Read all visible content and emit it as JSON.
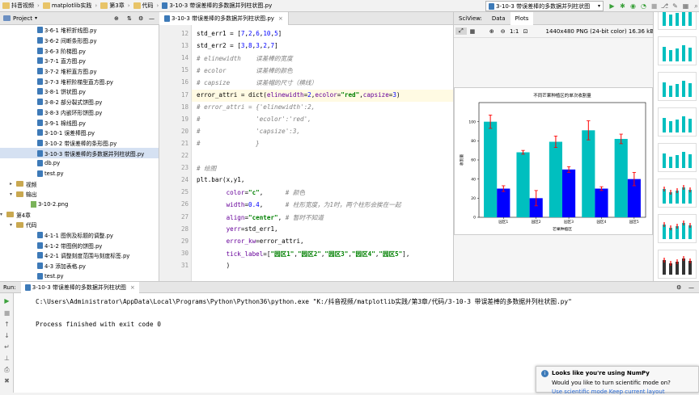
{
  "nav": {
    "crumbs": [
      "抖音视频",
      "matplotlib实践",
      "第3章",
      "代码",
      "3-10-3 带误差棒的多数据并列柱状图.py"
    ],
    "run_config": "3-10-3 带误差棒的多数据并列柱状图"
  },
  "project": {
    "title": "Project",
    "items": [
      {
        "name": "3-6-1 堆积折线图.py",
        "type": "py",
        "indent": 46
      },
      {
        "name": "3-6-2 间断条形图.py",
        "type": "py",
        "indent": 46
      },
      {
        "name": "3-6-3 阶梯图.py",
        "type": "py",
        "indent": 46
      },
      {
        "name": "3-7-1 直方图.py",
        "type": "py",
        "indent": 46
      },
      {
        "name": "3-7-2 堆积直方图.py",
        "type": "py",
        "indent": 46
      },
      {
        "name": "3-7-3 堆积阶梯型直方图.py",
        "type": "py",
        "indent": 46
      },
      {
        "name": "3-8-1 饼状图.py",
        "type": "py",
        "indent": 46
      },
      {
        "name": "3-8-2 部分裂式饼图.py",
        "type": "py",
        "indent": 46
      },
      {
        "name": "3-8-3 内嵌环形饼图.py",
        "type": "py",
        "indent": 46
      },
      {
        "name": "3-9-1 棉线图.py",
        "type": "py",
        "indent": 46
      },
      {
        "name": "3-10-1 误差棒图.py",
        "type": "py",
        "indent": 46
      },
      {
        "name": "3-10-2 带误差棒的条形图.py",
        "type": "py",
        "indent": 46
      },
      {
        "name": "3-10-3 带误差棒的多数据并列柱状图.py",
        "type": "py",
        "indent": 46,
        "selected": true
      },
      {
        "name": "db.py",
        "type": "py",
        "indent": 46
      },
      {
        "name": "test.py",
        "type": "py",
        "indent": 46
      },
      {
        "name": "视频",
        "type": "folder",
        "indent": 22,
        "arrow": "▸"
      },
      {
        "name": "输出",
        "type": "folder",
        "indent": 22,
        "arrow": "▾"
      },
      {
        "name": "3-10-2.png",
        "type": "png",
        "indent": 38
      },
      {
        "name": "第4章",
        "type": "folder",
        "indent": 10,
        "arrow": "▾"
      },
      {
        "name": "代码",
        "type": "folder",
        "indent": 22,
        "arrow": "▾"
      },
      {
        "name": "4-1-1 图例及标题的调整.py",
        "type": "py",
        "indent": 46
      },
      {
        "name": "4-1-2 带图例的饼图.py",
        "type": "py",
        "indent": 46
      },
      {
        "name": "4-2-1 调整刻度范围与刻度标签.py",
        "type": "py",
        "indent": 46
      },
      {
        "name": "4-3 添加表格.py",
        "type": "py",
        "indent": 46
      },
      {
        "name": "test.py",
        "type": "py",
        "indent": 46
      }
    ]
  },
  "editor": {
    "tab": "3-10-3 带误差棒的多数据并列柱状图.py",
    "lines": [
      {
        "n": "12",
        "html": "std_err1 = [<span class=num>7</span>,<span class=num>2</span>,<span class=num>6</span>,<span class=num>10</span>,<span class=num>5</span>]"
      },
      {
        "n": "13",
        "html": "std_err2 = [<span class=num>3</span>,<span class=num>8</span>,<span class=num>3</span>,<span class=num>2</span>,<span class=num>7</span>]"
      },
      {
        "n": "14",
        "html": "<span class=cmt># elinewidth    误差棒的宽度</span>"
      },
      {
        "n": "15",
        "html": "<span class=cmt># ecolor        误差棒的颜色</span>"
      },
      {
        "n": "16",
        "html": "<span class=cmt># capsize       误差帽的尺寸（横线）</span>"
      },
      {
        "n": "17",
        "html": "error_attri = dict(<span class=kw>elinewidth</span>=<span class=num>2</span>,<span class=kw>ecolor</span>=<span class=str>\"red\"</span>,<span class=kw>capsize</span>=<span class=num>3</span>)",
        "current": true
      },
      {
        "n": "18",
        "html": "<span class=cmt># error_attri = {'elinewidth':2,</span>"
      },
      {
        "n": "19",
        "html": "<span class=cmt>#               'ecolor':'red',</span>"
      },
      {
        "n": "20",
        "html": "<span class=cmt>#               'capsize':3,</span>"
      },
      {
        "n": "21",
        "html": "<span class=cmt>#               }</span>"
      },
      {
        "n": "22",
        "html": ""
      },
      {
        "n": "23",
        "html": "<span class=cmt># 绘图</span>"
      },
      {
        "n": "24",
        "html": "plt.bar(x,y1,"
      },
      {
        "n": "25",
        "html": "        <span class=kw>color</span>=<span class=str>\"c\"</span>,      <span class=cmt># 颜色</span>"
      },
      {
        "n": "26",
        "html": "        <span class=kw>width</span>=<span class=num>0.4</span>,      <span class=cmt># 柱形宽度，为1时，两个柱形会挨在一起</span>"
      },
      {
        "n": "27",
        "html": "        <span class=kw>align</span>=<span class=str>\"center\"</span>, <span class=cmt># 暂时不知道</span>"
      },
      {
        "n": "28",
        "html": "        <span class=kw>yerr</span>=std_err1,"
      },
      {
        "n": "29",
        "html": "        <span class=kw>error_kw</span>=error_attri,"
      },
      {
        "n": "30",
        "html": "        <span class=kw>tick_label</span>=[<span class=str>\"园区1\"</span>,<span class=str>\"园区2\"</span>,<span class=str>\"园区3\"</span>,<span class=str>\"园区4\"</span>,<span class=str>\"园区5\"</span>],"
      },
      {
        "n": "31",
        "html": "        )"
      }
    ]
  },
  "sciview": {
    "label": "SciView:",
    "tabs": [
      "Data",
      "Plots"
    ],
    "image_info": "1440x480 PNG (24-bit color) 16.36 kB"
  },
  "chart_data": {
    "type": "bar",
    "title": "不同芒果种植区的单次收割量",
    "xlabel": "芒果种植区",
    "ylabel": "收割量",
    "categories": [
      "园区1",
      "园区2",
      "园区3",
      "园区4",
      "园区5"
    ],
    "series": [
      {
        "values": [
          100,
          68,
          79,
          91,
          82
        ],
        "errors": [
          7,
          2,
          6,
          10,
          5
        ],
        "color": "#00bfbf"
      },
      {
        "values": [
          30,
          20,
          50,
          30,
          40
        ],
        "errors": [
          3,
          8,
          3,
          2,
          7
        ],
        "color": "#0000ff"
      }
    ],
    "ylim": [
      0,
      120
    ],
    "yticks": [
      0,
      20,
      40,
      60,
      80,
      100
    ],
    "error_color": "#ff0000"
  },
  "run": {
    "label": "Run:",
    "tab": "3-10-3 带误差棒的多数据并列柱状图",
    "command": "C:\\Users\\Administrator\\AppData\\Local\\Programs\\Python\\Python36\\python.exe \"K:/抖音视频/matplotlib实践/第3章/代码/3-10-3 带误差棒的多数据并列柱状图.py\"",
    "result": "Process finished with exit code 0"
  },
  "notification": {
    "title": "Looks like you're using NumPy",
    "body": "Would you like to turn scientific mode on?",
    "links": "Use scientific mode   Keep current layout"
  },
  "colors": {
    "accent": "#3d7ab8",
    "selection": "#d5e1f2",
    "run_green": "#3ca13c"
  }
}
